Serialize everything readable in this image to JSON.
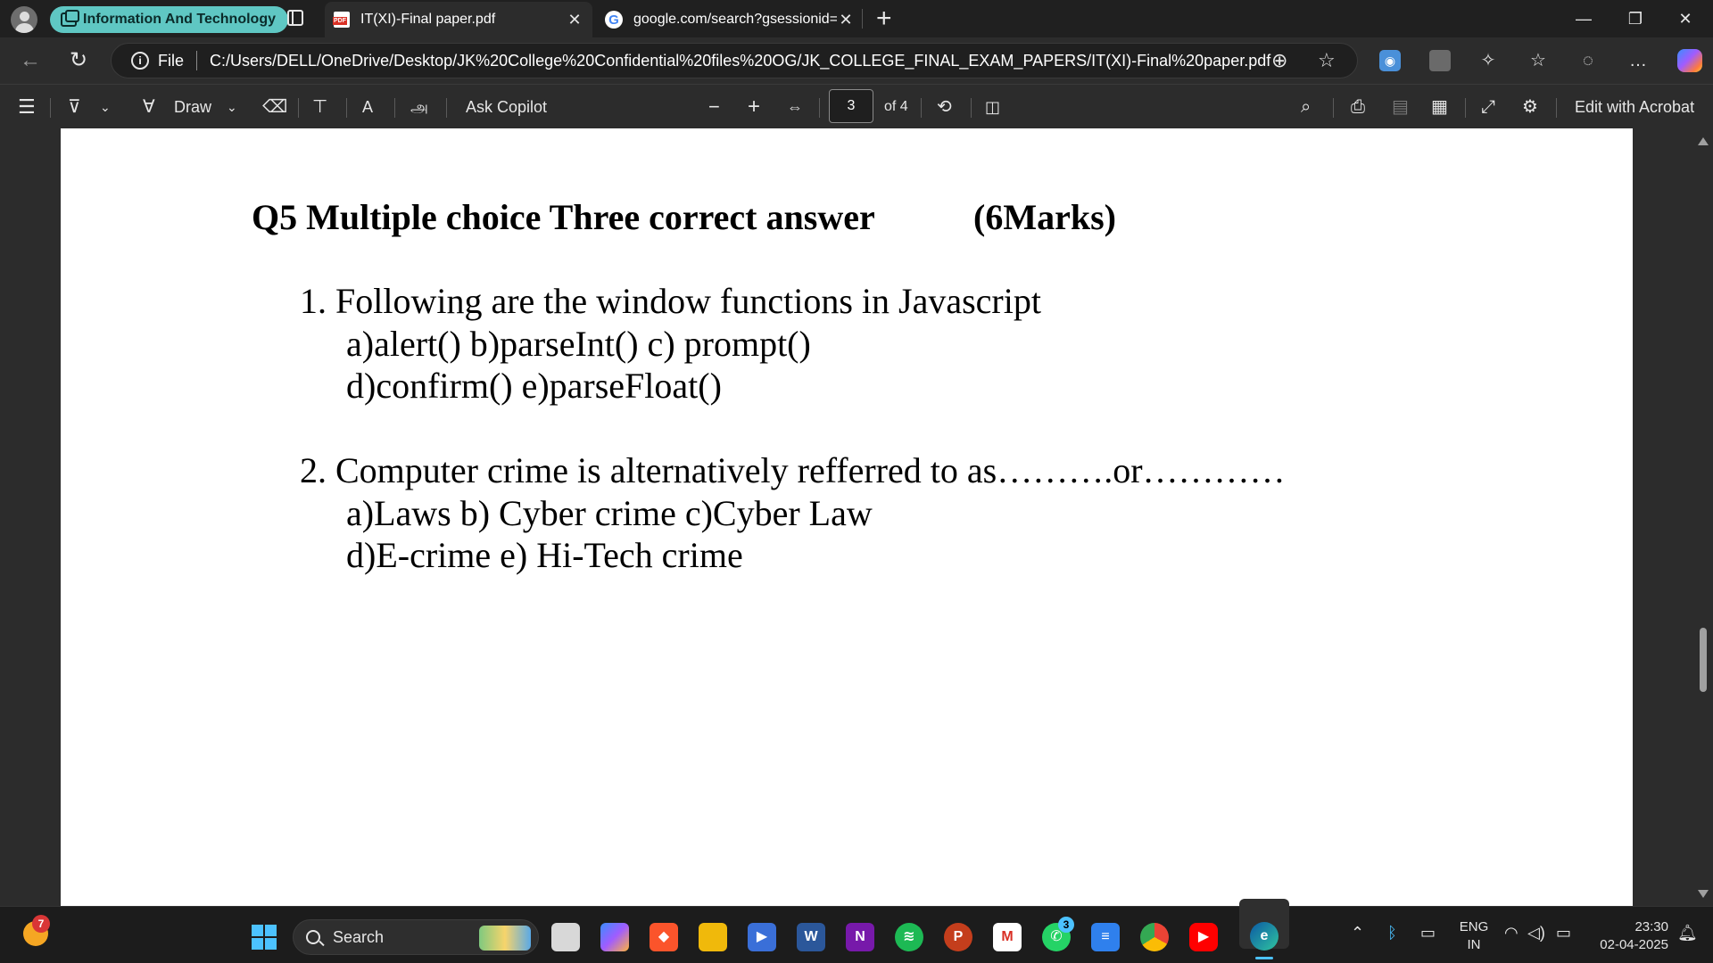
{
  "tabs": {
    "group_label": "Information And Technology",
    "active": {
      "title": "IT(XI)-Final paper.pdf",
      "icon": "pdf-icon"
    },
    "inactive": {
      "title": "google.com/search?gsessionid=D",
      "icon": "google-icon"
    },
    "close_glyph": "✕",
    "new_tab_glyph": "+"
  },
  "window_controls": {
    "minimize": "—",
    "maximize": "❐",
    "close": "✕"
  },
  "address_bar": {
    "scheme_label": "File",
    "url": "C:/Users/DELL/OneDrive/Desktop/JK%20College%20Confidential%20files%20OG/JK_COLLEGE_FINAL_EXAM_PAPERS/IT(XI)-Final%20paper.pdf"
  },
  "pdf_toolbar": {
    "draw_label": "Draw",
    "ask_copilot_label": "Ask Copilot",
    "current_page": "3",
    "page_count_label": "of 4",
    "edit_acrobat_label": "Edit with Acrobat",
    "translate_glyph": "அ",
    "read_aloud_glyph": "A"
  },
  "document": {
    "heading": "Q5 Multiple choice Three correct answer",
    "marks": "(6Marks)",
    "questions": [
      {
        "line": "1.  Following are the window functions in Javascript",
        "options_1": "a)alert()   b)parseInt()   c) prompt()",
        "options_2": "d)confirm()   e)parseFloat()"
      },
      {
        "line": "2.  Computer crime is alternatively refferred to as……….or…………",
        "options_1": "a)Laws  b) Cyber crime  c)Cyber Law",
        "options_2": "d)E-crime  e) Hi-Tech crime"
      }
    ]
  },
  "taskbar": {
    "widget_badge": "7",
    "search_label": "Search",
    "whatsapp_badge": "3",
    "language_line1": "ENG",
    "language_line2": "IN",
    "time": "23:30",
    "date": "02-04-2025"
  }
}
